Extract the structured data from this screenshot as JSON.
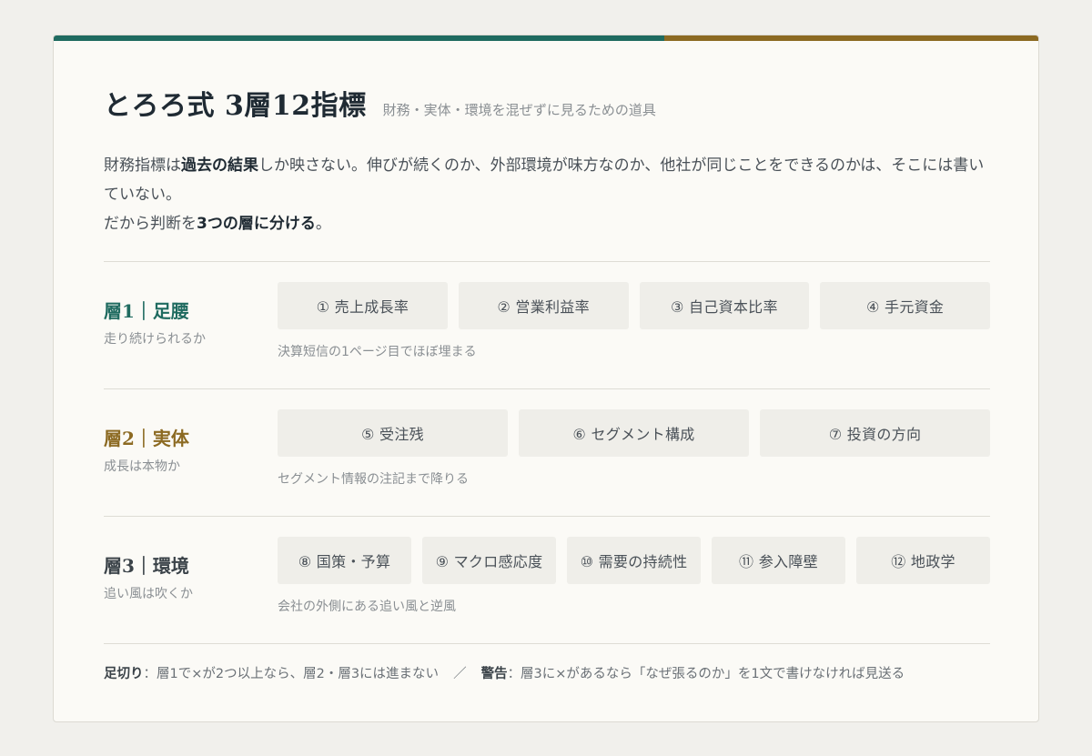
{
  "colors": {
    "accent_teal": "#1f6b60",
    "accent_brown": "#8c6a22",
    "layer1": "#1f6b60",
    "layer2": "#8c6a22",
    "layer3": "#3b4349"
  },
  "header": {
    "title": "とろろ式 3層12指標",
    "subtitle": "財務・実体・環境を混ぜずに見るための道具"
  },
  "intro": {
    "line1_pre": "財務指標は",
    "line1_bold": "過去の結果",
    "line1_post": "しか映さない。伸びが続くのか、外部環境が味方なのか、他社が同じことをできるのかは、そこには書いていない。",
    "line2_pre": "だから判断を",
    "line2_bold": "3つの層に分ける",
    "line2_post": "。"
  },
  "layers": [
    {
      "name": "層1｜足腰",
      "desc": "走り続けられるか",
      "items": [
        "① 売上成長率",
        "② 営業利益率",
        "③ 自己資本比率",
        "④ 手元資金"
      ],
      "note": "決算短信の1ページ目でほぼ埋まる"
    },
    {
      "name": "層2｜実体",
      "desc": "成長は本物か",
      "items": [
        "⑤ 受注残",
        "⑥ セグメント構成",
        "⑦ 投資の方向"
      ],
      "note": "セグメント情報の注記まで降りる"
    },
    {
      "name": "層3｜環境",
      "desc": "追い風は吹くか",
      "items": [
        "⑧ 国策・予算",
        "⑨ マクロ感応度",
        "⑩ 需要の持続性",
        "⑪ 参入障壁",
        "⑫ 地政学"
      ],
      "note": "会社の外側にある追い風と逆風"
    }
  ],
  "footer": {
    "cutoff_label": "足切り",
    "cutoff_text": "：層1で×が2つ以上なら、層2・層3には進まない",
    "separator": "／",
    "warning_label": "警告",
    "warning_text": "：層3に×があるなら「なぜ張るのか」を1文で書けなければ見送る"
  }
}
